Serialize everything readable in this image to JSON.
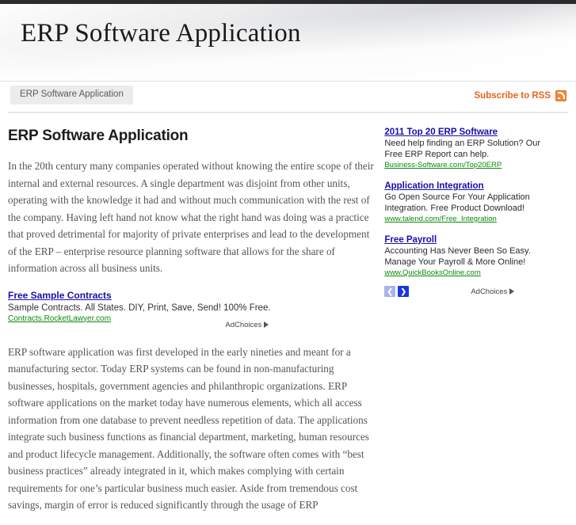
{
  "site": {
    "banner_title": "ERP Software Application",
    "top_strip_color": "#2b2b2b"
  },
  "nav": {
    "tab_label": "ERP Software Application",
    "rss_label": "Subscribe to RSS",
    "rss_icon": "rss-icon"
  },
  "main": {
    "page_title": "ERP Software Application",
    "paragraph_1": "In the 20th century many companies operated without knowing the entire scope of their internal and external resources. A single department was disjoint from other units, operating with the knowledge it had and without much communication with the rest of the company. Having left hand not know what the right hand was doing was a practice that proved detrimental for majority of private enterprises and lead to the development of the ERP – enterprise resource planning software that allows for the share of information across all business units.",
    "paragraph_2": "ERP software application was first developed in the early nineties and meant for a manufacturing sector. Today ERP systems can be found in non-manufacturing businesses, hospitals, government agencies and philanthropic organizations. ERP software applications on the market today have numerous elements, which all access information from one database to prevent needless repetition of data. The applications integrate such business functions as financial department, marketing, human resources and product lifecycle management. Additionally, the software often comes with “best business practices” already integrated in it, which makes complying with certain requirements for one’s particular business much easier. Aside from tremendous cost savings, margin of error is reduced significantly through the usage of ERP"
  },
  "inline_ad": {
    "title": "Free Sample Contracts",
    "description": "Sample Contracts. All States. DIY, Print, Save, Send! 100% Free.",
    "url": "Contracts.RocketLawyer.com",
    "adchoices_label": "AdChoices"
  },
  "sidebar": {
    "ads": [
      {
        "title": "2011 Top 20 ERP Software",
        "line1": "Need help finding an ERP Solution? Our",
        "line2": "Free ERP Report can help.",
        "url": "Business-Software.com/Top20ERP"
      },
      {
        "title": "Application Integration",
        "line1": "Go Open Source For Your Application",
        "line2": "Integration. Free Product Download!",
        "url": "www.talend.com/Free_Integration"
      },
      {
        "title": "Free Payroll",
        "line1": "Accounting Has Never Been So Easy.",
        "line2": "Manage Your Payroll & More Online!",
        "url": "www.QuickBooksOnline.com"
      }
    ],
    "prev_arrow": "❮",
    "next_arrow": "❯",
    "adchoices_label": "AdChoices"
  },
  "colors": {
    "ad_title_blue": "#1a0dab",
    "ad_url_green": "#0c8a0c",
    "rss_orange": "#e8621a",
    "next_arrow_blue": "#1b37dd",
    "prev_arrow_blue": "#a9b4e8"
  }
}
